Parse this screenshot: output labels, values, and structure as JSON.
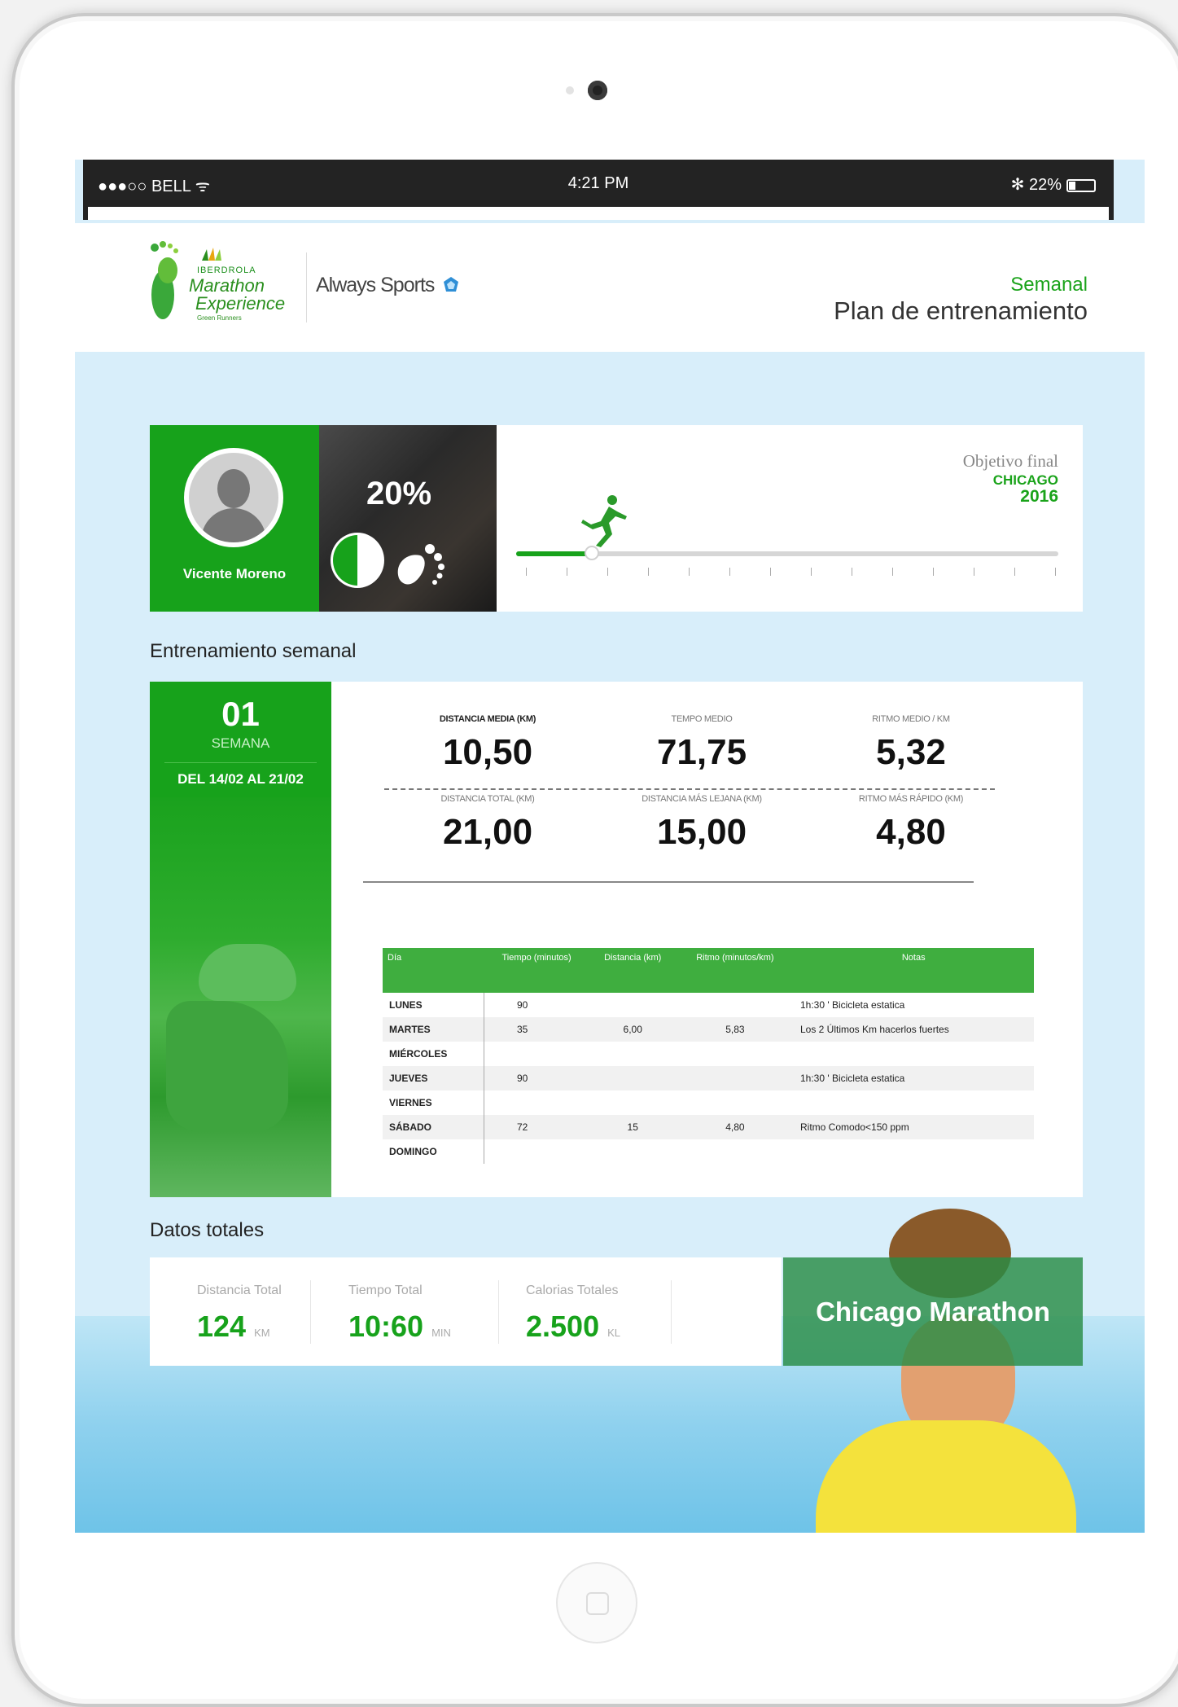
{
  "status_bar": {
    "carrier": "●●●○○ BELL ᯤ",
    "time": "4:21 PM",
    "battery": "✻ 22%"
  },
  "header": {
    "brand_small": "IBERDROLA",
    "brand_line1": "Marathon",
    "brand_line2": "Experience",
    "brand_tag": "Green Runners",
    "partner": "Always Sports",
    "subtitle": "Semanal",
    "title": "Plan de entrenamiento"
  },
  "profile": {
    "name": "Vicente Moreno",
    "progress_label": "20%",
    "progress": 0.14,
    "objective_label": "Objetivo final",
    "objective_city": "CHICAGO",
    "objective_year": "2016"
  },
  "sections": {
    "weekly_title": "Entrenamiento semanal",
    "totals_title": "Datos totales"
  },
  "week": {
    "number": "01",
    "label": "SEMANA",
    "range": "DEL 14/02 AL 21/02"
  },
  "stats": [
    {
      "label": "DISTANCIA MEDIA (KM)",
      "value": "10,50"
    },
    {
      "label": "TEMPO MEDIO",
      "value": "71,75"
    },
    {
      "label": "RITMO MEDIO / KM",
      "value": "5,32"
    },
    {
      "label": "DISTANCIA TOTAL (KM)",
      "value": "21,00"
    },
    {
      "label": "DISTANCIA MÁS LEJANA (KM)",
      "value": "15,00"
    },
    {
      "label": "RITMO MÁS RÁPIDO (KM)",
      "value": "4,80"
    }
  ],
  "table": {
    "headers": [
      "Día",
      "Tiempo (minutos)",
      "Distancia (km)",
      "Ritmo (minutos/km)",
      "Notas"
    ],
    "rows": [
      [
        "LUNES",
        "90",
        "",
        "",
        "1h:30 ' Bicicleta estatica"
      ],
      [
        "MARTES",
        "35",
        "6,00",
        "5,83",
        "Los 2 Últimos Km hacerlos fuertes"
      ],
      [
        "MIÉRCOLES",
        "",
        "",
        "",
        ""
      ],
      [
        "JUEVES",
        "90",
        "",
        "",
        "1h:30 ' Bicicleta estatica"
      ],
      [
        "VIERNES",
        "",
        "",
        "",
        ""
      ],
      [
        "SÁBADO",
        "72",
        "15",
        "4,80",
        "Ritmo Comodo<150 ppm"
      ],
      [
        "DOMINGO",
        "",
        "",
        "",
        ""
      ]
    ]
  },
  "totals": [
    {
      "label": "Distancia Total",
      "value": "124",
      "unit": "KM"
    },
    {
      "label": "Tiempo Total",
      "value": "10:60",
      "unit": "MIN"
    },
    {
      "label": "Calorias Totales",
      "value": "2.500",
      "unit": "KL"
    }
  ],
  "banner": "Chicago Marathon",
  "colors": {
    "accent": "#17a21b",
    "background": "#d8eefa"
  }
}
